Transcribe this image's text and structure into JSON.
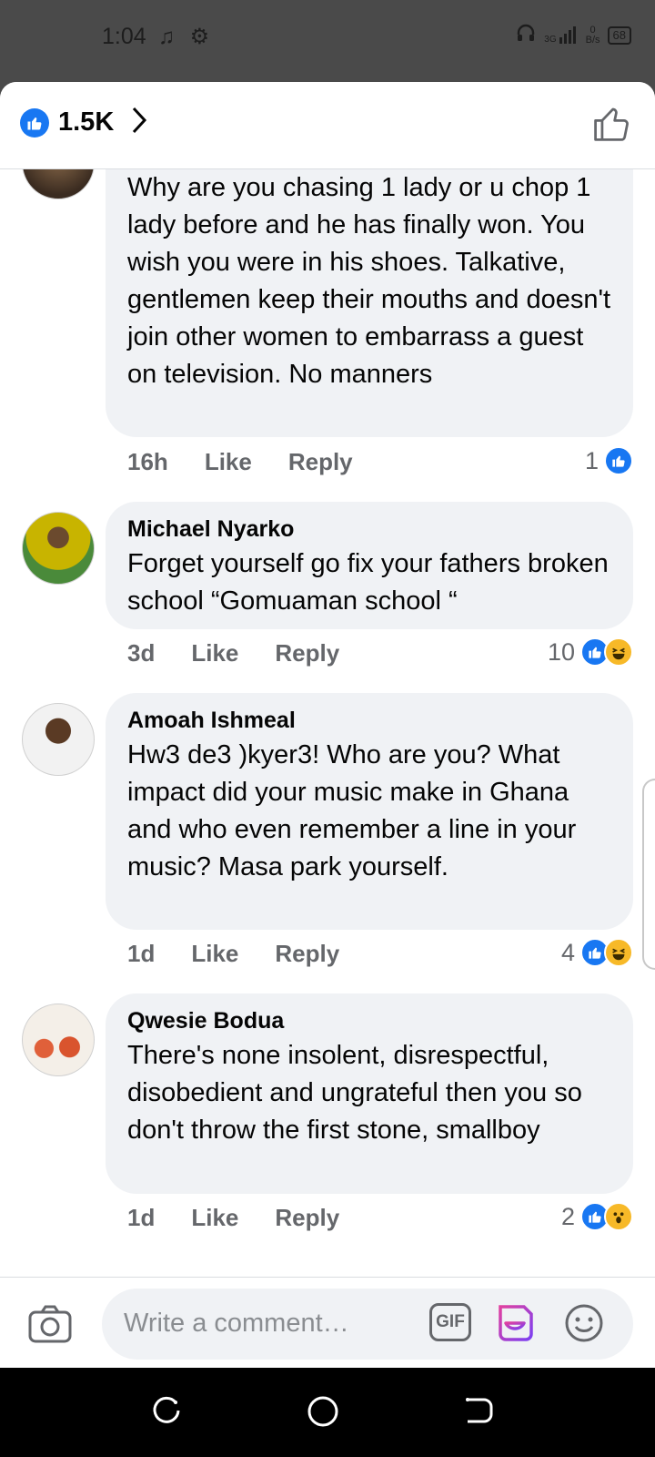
{
  "status_bar": {
    "time": "1:04",
    "net_speed_value": "0",
    "net_speed_unit": "B/s",
    "signal": "3G",
    "battery": "68"
  },
  "header": {
    "reaction_count": "1.5K"
  },
  "comments": [
    {
      "author": "",
      "text": "Why are you chasing 1 lady or u chop 1 lady before and he has finally won. You wish you were in his shoes. Talkative,  gentlemen keep their mouths and doesn't join other women to embarrass a guest on television. No manners",
      "time": "16h",
      "like_label": "Like",
      "reply_label": "Reply",
      "reaction_count": "1",
      "reactions": [
        "like"
      ]
    },
    {
      "author": "Michael Nyarko",
      "text": "Forget yourself go fix your fathers broken school “Gomuaman school “",
      "time": "3d",
      "like_label": "Like",
      "reply_label": "Reply",
      "reaction_count": "10",
      "reactions": [
        "like",
        "haha"
      ]
    },
    {
      "author": "Amoah Ishmeal",
      "text": "Hw3 de3 )kyer3! Who are you? What impact did your music make in Ghana and who even remember a line in your music? Masa park yourself.",
      "time": "1d",
      "like_label": "Like",
      "reply_label": "Reply",
      "reaction_count": "4",
      "reactions": [
        "like",
        "haha"
      ]
    },
    {
      "author": "Qwesie Bodua",
      "text": "There's none insolent, disrespectful, disobedient and ungrateful then you so don't throw the first stone, smallboy",
      "time": "1d",
      "like_label": "Like",
      "reply_label": "Reply",
      "reaction_count": "2",
      "reactions": [
        "like",
        "wow"
      ]
    }
  ],
  "composer": {
    "placeholder": "Write a comment…",
    "gif_label": "GIF"
  },
  "colors": {
    "brand_blue": "#1877f2",
    "bubble_bg": "#f0f2f5",
    "meta_gray": "#65676b",
    "reaction_yellow": "#f7b928"
  }
}
